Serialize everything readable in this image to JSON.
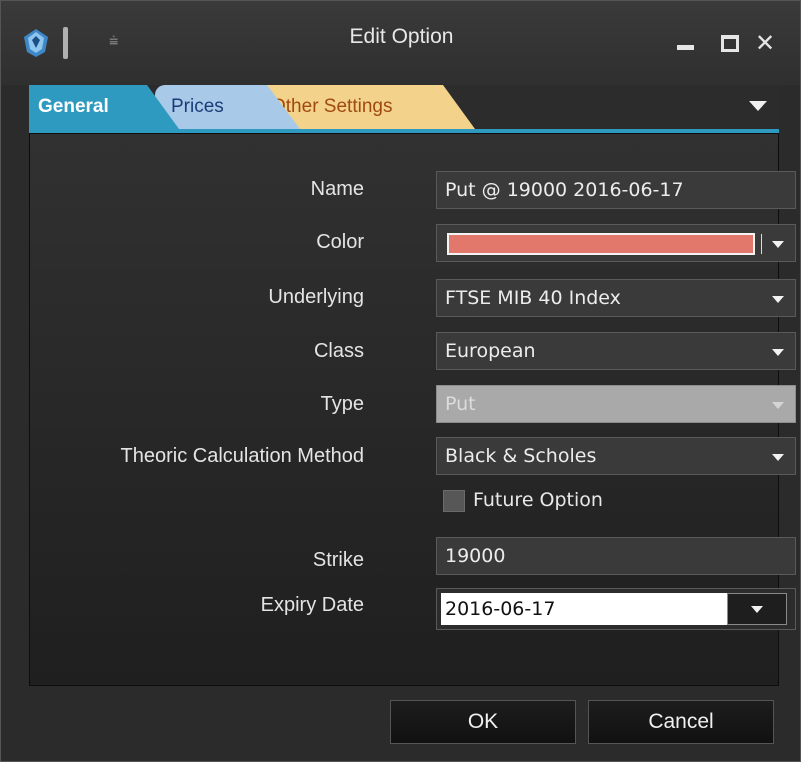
{
  "window": {
    "title": "Edit Option",
    "min_icon": "minimize-icon",
    "max_icon": "maximize-icon",
    "close_glyph": "✕",
    "pin_glyph": "⩧"
  },
  "tabs": [
    {
      "label": "General",
      "color": "#2f9ac0"
    },
    {
      "label": "Prices",
      "color": "#a9c9e8"
    },
    {
      "label": "Other Settings",
      "color": "#f3d28b"
    }
  ],
  "form": {
    "name_label": "Name",
    "name_value": "Put @ 19000 2016-06-17",
    "color_label": "Color",
    "color_value": "#e2786b",
    "underlying_label": "Underlying",
    "underlying_value": "FTSE MIB 40 Index",
    "class_label": "Class",
    "class_value": "European",
    "type_label": "Type",
    "type_value": "Put",
    "method_label": "Theoric Calculation Method",
    "method_value": "Black & Scholes",
    "future_option_label": "Future Option",
    "future_option_checked": false,
    "strike_label": "Strike",
    "strike_value": "19000",
    "expiry_label": "Expiry Date",
    "expiry_value": "2016-06-17"
  },
  "buttons": {
    "ok": "OK",
    "cancel": "Cancel"
  }
}
